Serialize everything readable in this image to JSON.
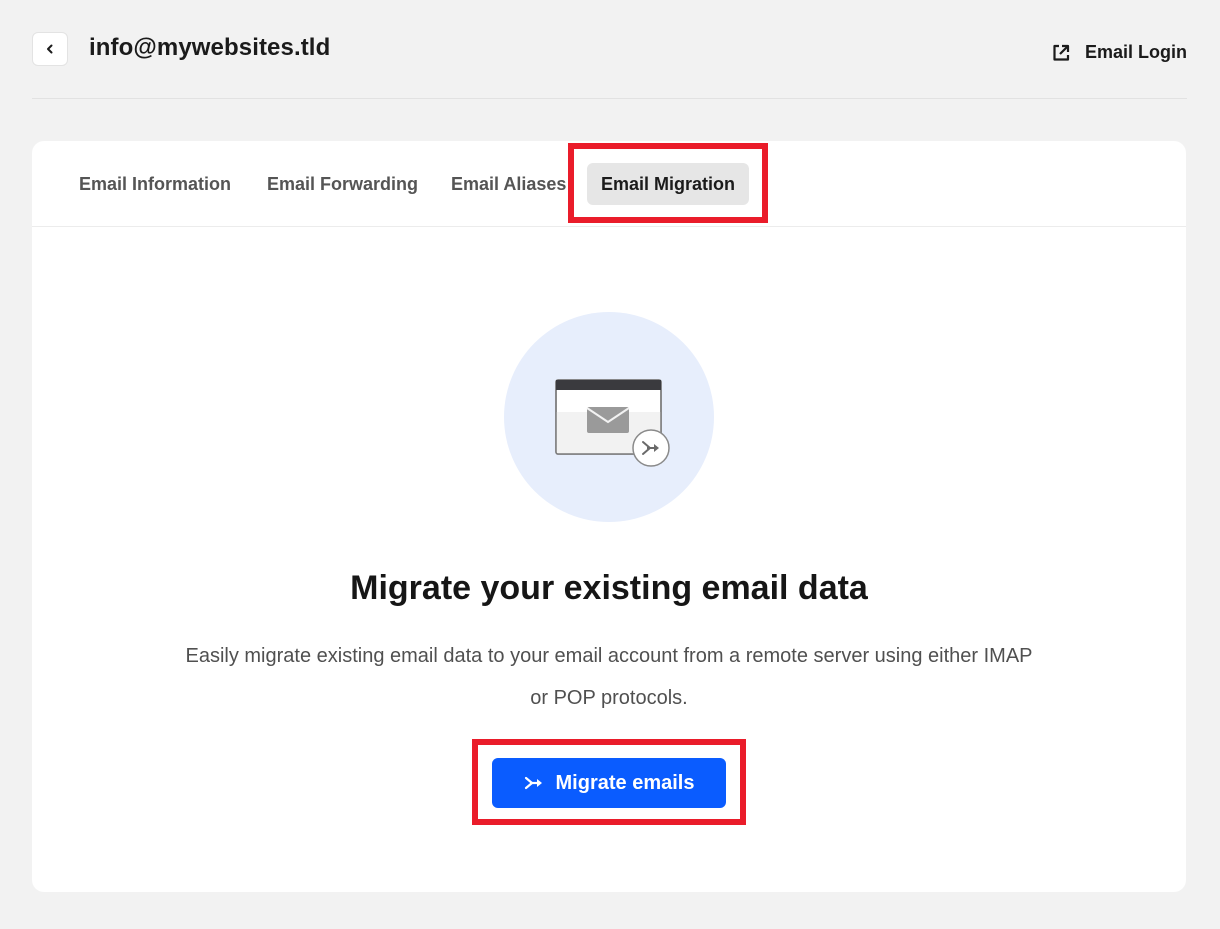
{
  "header": {
    "title": "info@mywebsites.tld",
    "back_icon": "chevron-left-icon",
    "email_login_label": "Email Login",
    "email_login_icon": "external-link-icon"
  },
  "tabs": [
    {
      "label": "Email Information",
      "active": false
    },
    {
      "label": "Email Forwarding",
      "active": false
    },
    {
      "label": "Email Aliases",
      "active": false
    },
    {
      "label": "Email Migration",
      "active": true
    }
  ],
  "main": {
    "illustration_icon": "email-migration-icon",
    "headline": "Migrate your existing email data",
    "description": "Easily migrate existing email data to your email account from a remote server using either IMAP or POP protocols.",
    "button_label": "Migrate emails",
    "button_icon": "migrate-arrows-icon"
  },
  "colors": {
    "page_background": "#f2f2f2",
    "card_background": "#ffffff",
    "primary_button": "#0a5cff",
    "highlight": "#ea1c2a",
    "illustration_circle": "#e7eefc"
  }
}
